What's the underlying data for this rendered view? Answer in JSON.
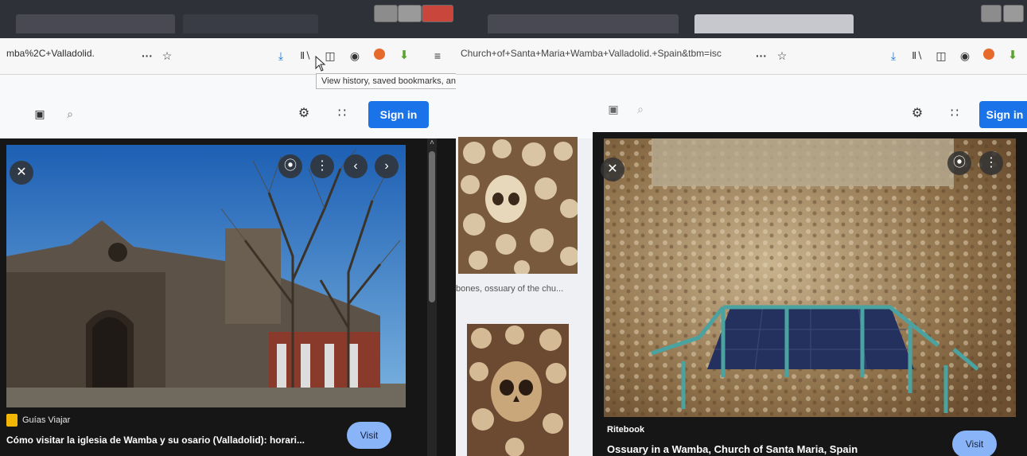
{
  "left_window": {
    "url_text": "mba%2C+Valladolid.",
    "page_actions_label": "···",
    "bookmark_star": "☆",
    "tooltip": "View history, saved bookmarks, and more",
    "sign_in": "Sign in",
    "preview": {
      "source": "Guías Viajar",
      "caption": "Cómo visitar la iglesia de Wamba y su osario (Valladolid): horari...",
      "visit": "Visit"
    },
    "scroll_arrow": "˄"
  },
  "right_window": {
    "url_text": "Church+of+Santa+Maria+Wamba+Valladolid.+Spain&tbm=isc",
    "page_actions_label": "···",
    "bookmark_star": "☆",
    "sign_in": "Sign in",
    "thumbnail_caption": "bones, ossuary of the chu...",
    "preview": {
      "source": "Ritebook",
      "caption": "Ossuary in a Wamba, Church of Santa Maria, Spain",
      "visit": "Visit"
    }
  },
  "icons": {
    "close": "✕",
    "more_vert": "⋮",
    "prev": "‹",
    "next": "›",
    "download": "⤓",
    "library": "Ⅱ∖",
    "sidebar": "◫",
    "account": "◉",
    "apps": "∷",
    "settings": "⚙",
    "camera": "▣",
    "search": "⌕"
  },
  "colors": {
    "sign_in_blue": "#1a73e8",
    "visit_pill": "#8ab4f8",
    "tab_bar": "#2f3138",
    "addon_orange": "#e56a2b",
    "addon_green": "#5aa32e"
  }
}
